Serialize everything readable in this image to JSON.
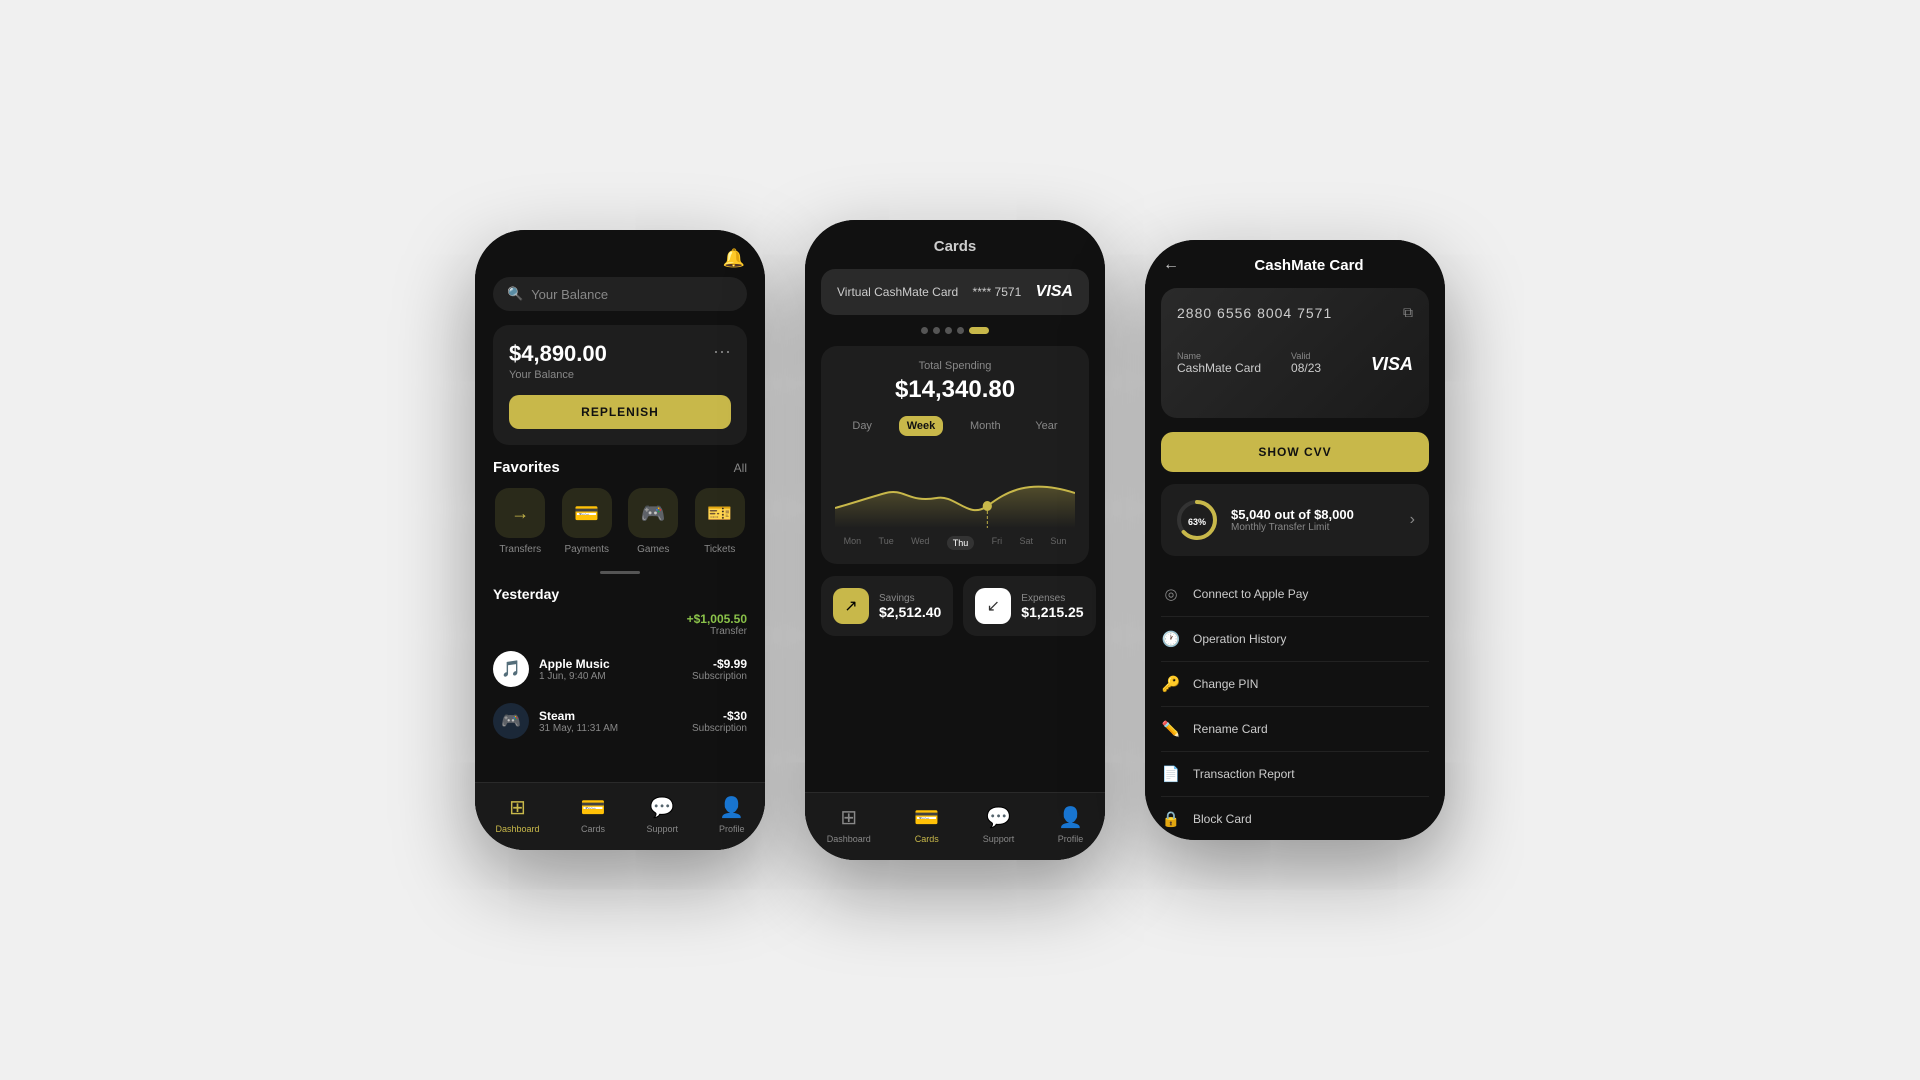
{
  "phone1": {
    "balance": "$4,890.00",
    "balance_label": "Your Balance",
    "replenish": "REPLENISH",
    "favorites_title": "Favorites",
    "all_label": "All",
    "favorites": [
      {
        "icon": "→",
        "label": "Transfers"
      },
      {
        "icon": "💳",
        "label": "Payments"
      },
      {
        "icon": "🎮",
        "label": "Games"
      },
      {
        "icon": "🎫",
        "label": "Tickets"
      }
    ],
    "yesterday_title": "Yesterday",
    "transfer_amount": "+$1,005.50",
    "transfer_type": "Transfer",
    "transactions": [
      {
        "icon": "🎵",
        "name": "Apple Music",
        "date": "1 Jun, 9:40 AM",
        "amount": "-$9.99",
        "sub": "Subscription"
      },
      {
        "icon": "🎮",
        "name": "Steam",
        "date": "31 May, 11:31 AM",
        "amount": "-$30",
        "sub": "Subscription"
      }
    ],
    "nav": [
      "Dashboard",
      "Cards",
      "Support",
      "Profile"
    ]
  },
  "phone2": {
    "title": "Cards",
    "card_name": "Virtual CashMate Card",
    "card_number": "**** 7571",
    "visa": "VISA",
    "spending_title": "Total Spending",
    "spending_amount": "$14,340.80",
    "periods": [
      "Day",
      "Week",
      "Month",
      "Year"
    ],
    "active_period": "Week",
    "chart_labels": [
      "Mon",
      "Tue",
      "Wed",
      "Thu",
      "Fri",
      "Sat",
      "Sun"
    ],
    "active_chart_label": "Thu",
    "savings_label": "Savings",
    "savings_amount": "$2,512.40",
    "expenses_label": "Expenses",
    "expenses_amount": "$1,215.25",
    "nav": [
      "Dashboard",
      "Cards",
      "Support",
      "Profile"
    ]
  },
  "phone3": {
    "back": "←",
    "title": "CashMate Card",
    "card_number": "2880 6556 8004 7571",
    "name_label": "Name",
    "name_value": "CashMate Card",
    "valid_label": "Valid",
    "valid_value": "08/23",
    "visa": "VISA",
    "show_cvv": "SHOW CVV",
    "limit_amount": "$5,040 out of $8,000",
    "limit_label": "Monthly Transfer Limit",
    "progress_pct": 63,
    "menu_items": [
      {
        "icon": "◎",
        "label": "Connect to Apple Pay"
      },
      {
        "icon": "🕐",
        "label": "Operation History"
      },
      {
        "icon": "🔑",
        "label": "Change PIN"
      },
      {
        "icon": "✏️",
        "label": "Rename Card"
      },
      {
        "icon": "📄",
        "label": "Transaction Report"
      },
      {
        "icon": "🔒",
        "label": "Block Card"
      }
    ]
  }
}
